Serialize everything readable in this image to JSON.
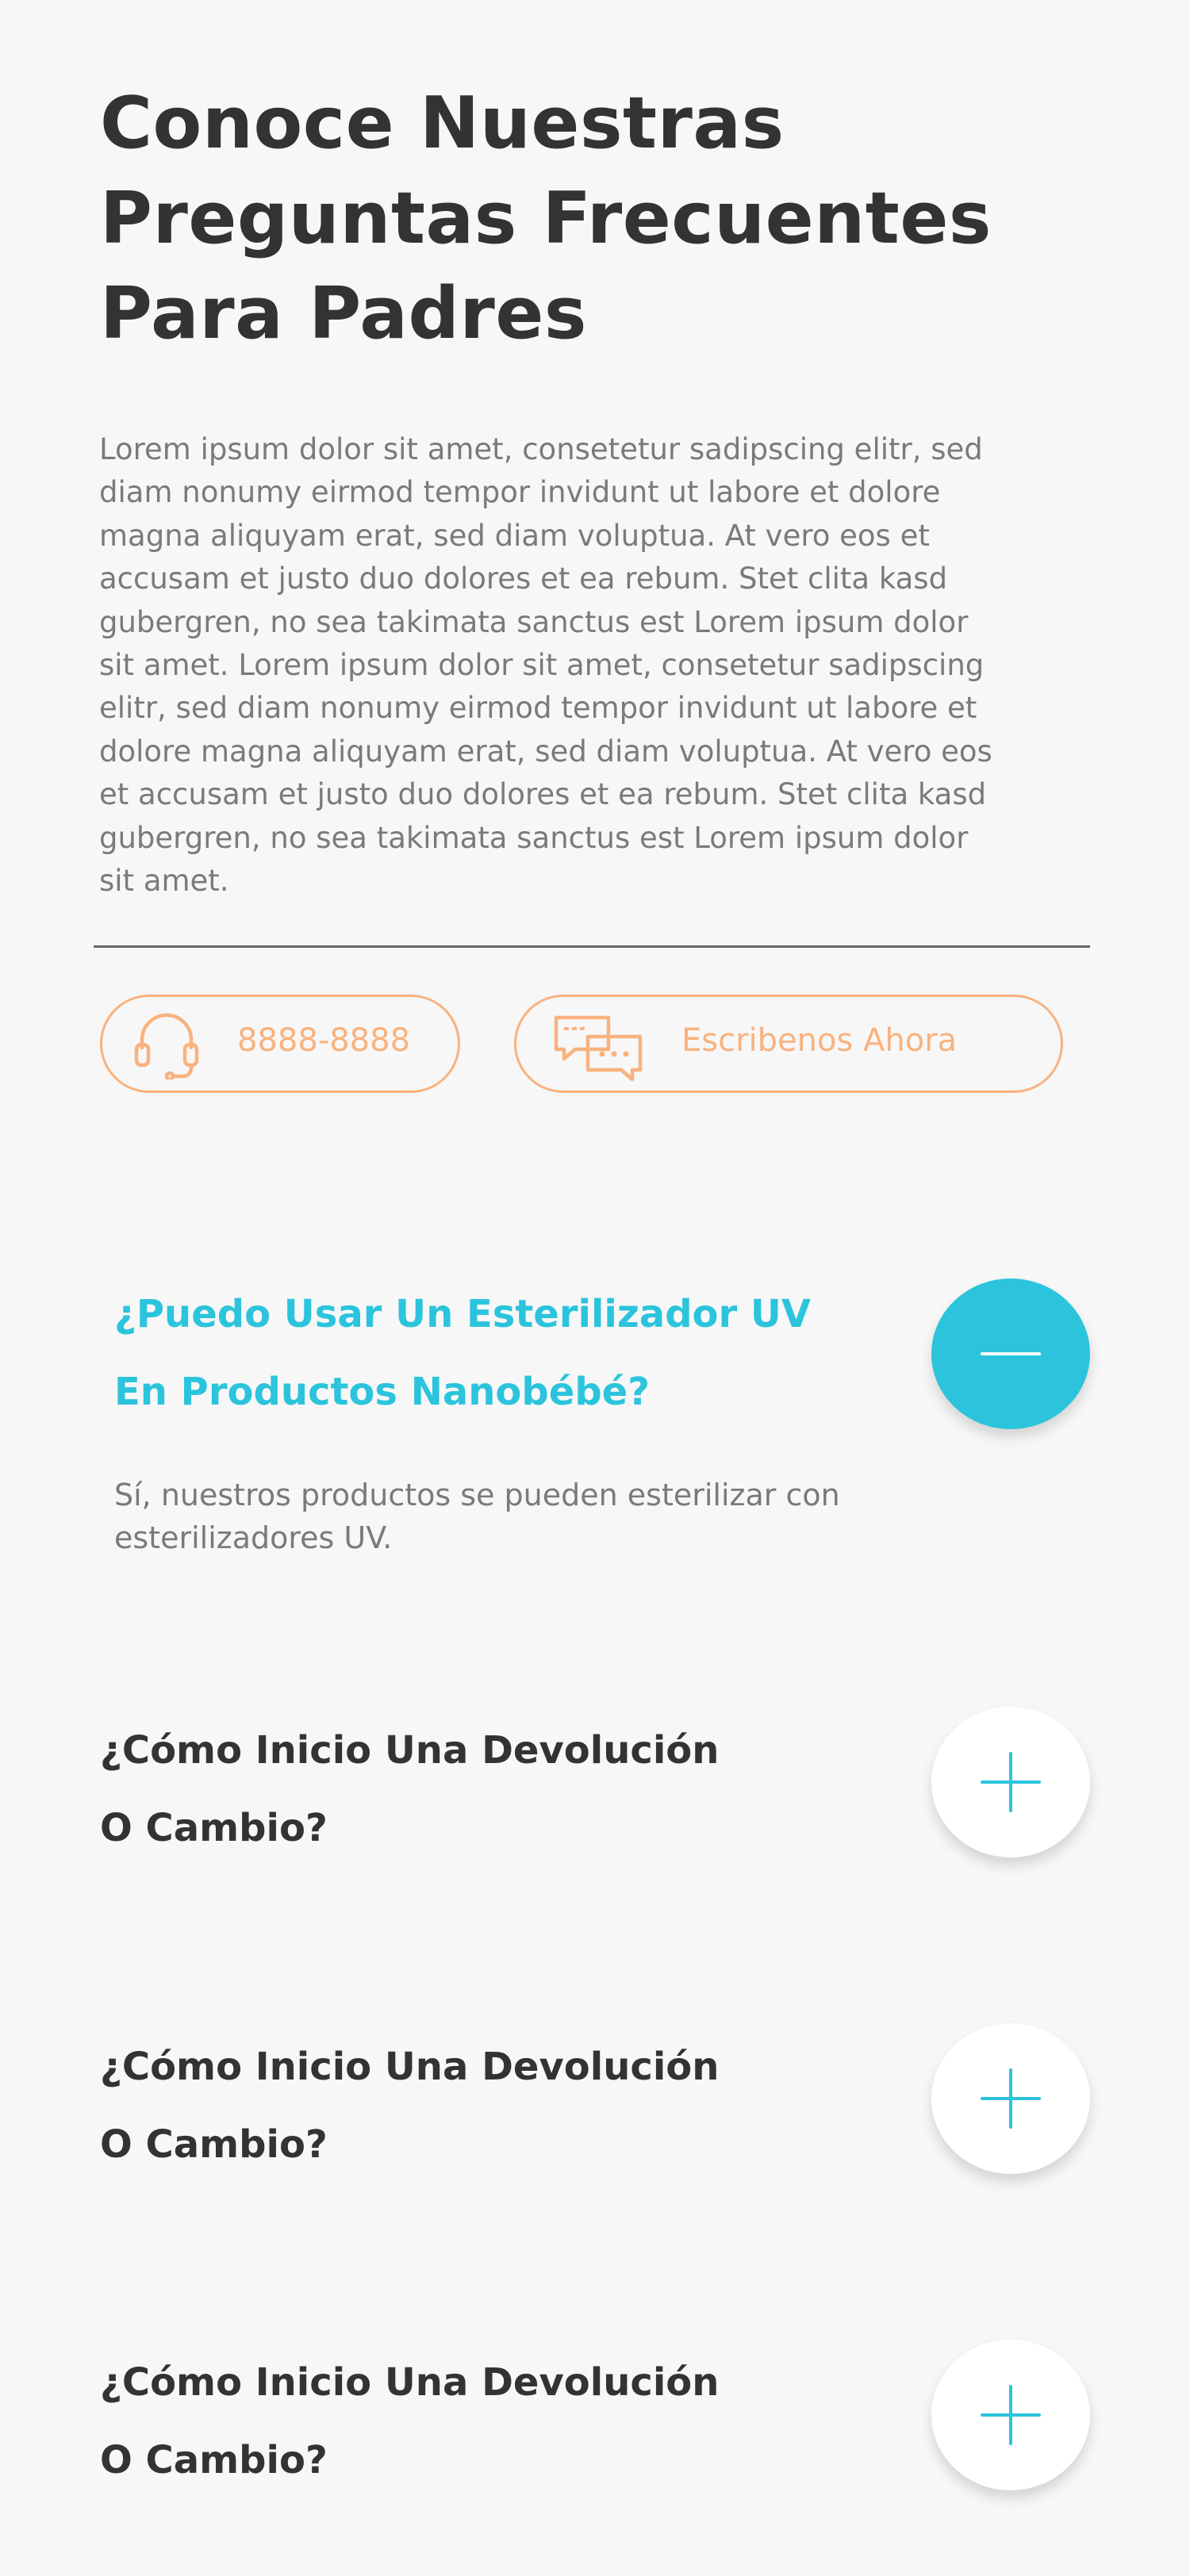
{
  "heading": {
    "lines": [
      "Conoce Nuestras",
      "Preguntas Frecuentes",
      "Para Padres"
    ]
  },
  "intro": {
    "lines": [
      "Lorem ipsum dolor sit amet, consetetur sadipscing elitr, sed",
      "diam nonumy eirmod tempor invidunt ut labore et dolore",
      "magna aliquyam erat, sed diam voluptua. At vero eos et",
      "accusam et justo duo dolores et ea rebum. Stet clita kasd",
      "gubergren, no sea takimata sanctus est Lorem ipsum dolor",
      "sit amet. Lorem ipsum dolor sit amet, consetetur sadipscing",
      "elitr, sed diam nonumy eirmod tempor invidunt ut labore et",
      "dolore magna aliquyam erat, sed diam voluptua. At vero eos",
      "et accusam et justo duo dolores et ea rebum. Stet clita kasd",
      "gubergren, no sea takimata sanctus est Lorem ipsum dolor",
      "sit amet."
    ]
  },
  "contact": {
    "phone_label": "8888-8888",
    "phone_icon": "headset-icon",
    "chat_label": "Escribenos Ahora",
    "chat_icon": "chat-bubbles-icon",
    "accent_color": "#f9b27e"
  },
  "faq": {
    "accent_color": "#2bc4dc",
    "items": [
      {
        "question_lines": [
          "¿Puedo Usar Un Esterilizador UV",
          "En Productos Nanobébé?"
        ],
        "answer_lines": [
          "Sí, nuestros productos se pueden esterilizar con",
          "esterilizadores UV."
        ],
        "expanded": true,
        "toggle_icon": "minus-icon"
      },
      {
        "question_lines": [
          "¿Cómo Inicio Una Devolución",
          "O Cambio?"
        ],
        "expanded": false,
        "toggle_icon": "plus-icon"
      },
      {
        "question_lines": [
          "¿Cómo Inicio Una Devolución",
          "O Cambio?"
        ],
        "expanded": false,
        "toggle_icon": "plus-icon"
      },
      {
        "question_lines": [
          "¿Cómo Inicio Una Devolución",
          "O Cambio?"
        ],
        "expanded": false,
        "toggle_icon": "plus-icon"
      }
    ]
  }
}
